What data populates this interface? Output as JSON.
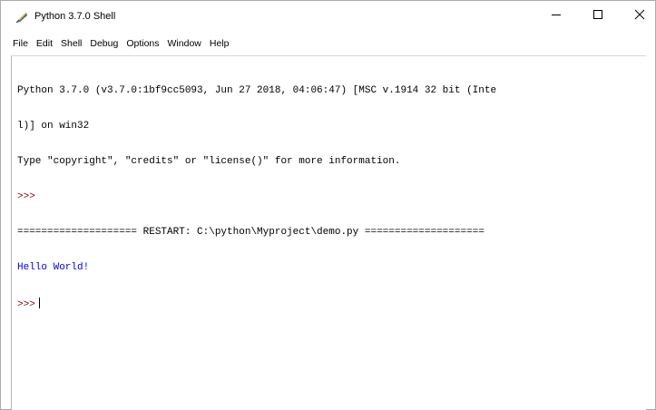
{
  "window": {
    "title": "Python 3.7.0 Shell",
    "icon": "python-feather-icon",
    "controls": {
      "minimize": "minimize-icon",
      "maximize": "maximize-icon",
      "close": "close-icon"
    }
  },
  "menu": [
    {
      "label": "File"
    },
    {
      "label": "Edit"
    },
    {
      "label": "Shell"
    },
    {
      "label": "Debug"
    },
    {
      "label": "Options"
    },
    {
      "label": "Window"
    },
    {
      "label": "Help"
    }
  ],
  "shell": {
    "banner_line1": "Python 3.7.0 (v3.7.0:1bf9cc5093, Jun 27 2018, 04:06:47) [MSC v.1914 32 bit (Inte",
    "banner_line2": "l)] on win32",
    "banner_line3": "Type \"copyright\", \"credits\" or \"license()\" for more information.",
    "prompt1": ">>>",
    "restart_line": "==================== RESTART: C:\\python\\Myproject\\demo.py ====================",
    "output": "Hello World!",
    "prompt2": ">>>"
  },
  "colors": {
    "prompt": "#8b0000",
    "stdout": "#0000e0",
    "text": "#000000"
  }
}
